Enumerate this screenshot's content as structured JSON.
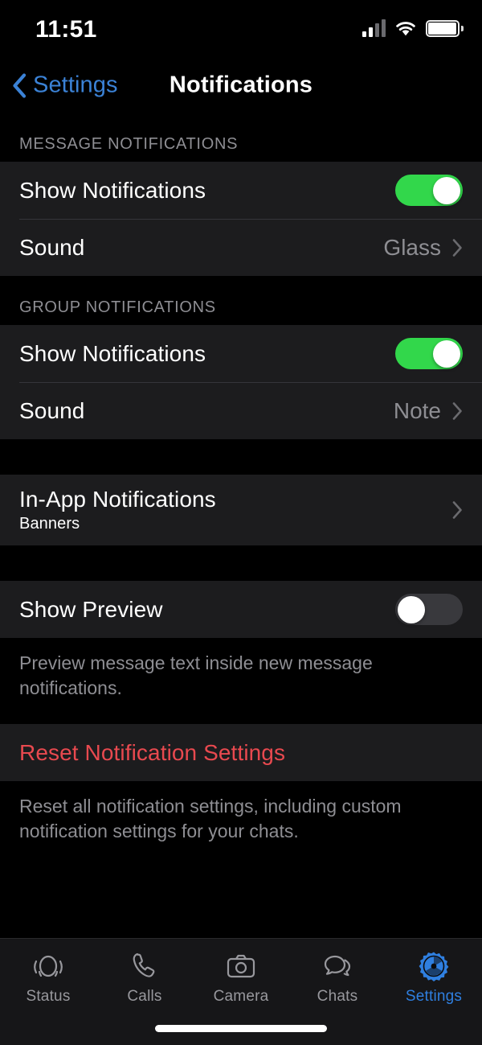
{
  "status_bar": {
    "time": "11:51",
    "cellular_icon": "cellular-signal-icon",
    "cellular_bars_filled": 2,
    "cellular_bars_total": 4,
    "wifi_icon": "wifi-icon",
    "battery_icon": "battery-icon"
  },
  "nav": {
    "back_icon": "chevron-left-icon",
    "back_label": "Settings",
    "title": "Notifications"
  },
  "sections": {
    "message": {
      "header": "MESSAGE NOTIFICATIONS",
      "show_notifications_label": "Show Notifications",
      "show_notifications_state": "on",
      "sound_label": "Sound",
      "sound_value": "Glass",
      "chevron_icon": "chevron-right-icon"
    },
    "group": {
      "header": "GROUP NOTIFICATIONS",
      "show_notifications_label": "Show Notifications",
      "show_notifications_state": "on",
      "sound_label": "Sound",
      "sound_value": "Note",
      "chevron_icon": "chevron-right-icon"
    },
    "in_app": {
      "label": "In-App Notifications",
      "sub": "Banners",
      "chevron_icon": "chevron-right-icon"
    },
    "preview": {
      "label": "Show Preview",
      "state": "off",
      "footer": "Preview message text inside new message notifications."
    },
    "reset": {
      "label": "Reset Notification Settings",
      "footer": "Reset all notification settings, including custom notification settings for your chats."
    }
  },
  "tabs": [
    {
      "label": "Status",
      "icon": "status-ring-icon",
      "active": false
    },
    {
      "label": "Calls",
      "icon": "phone-icon",
      "active": false
    },
    {
      "label": "Camera",
      "icon": "camera-icon",
      "active": false
    },
    {
      "label": "Chats",
      "icon": "chat-bubbles-icon",
      "active": false
    },
    {
      "label": "Settings",
      "icon": "gear-icon",
      "active": true
    }
  ],
  "colors": {
    "accent_blue": "#3b82d6",
    "toggle_on_green": "#32d74b",
    "toggle_off_gray": "#39393d",
    "destructive_red": "#e8494f",
    "cell_background": "#1c1c1e",
    "page_background": "#000000",
    "secondary_text": "#8e8e93"
  }
}
